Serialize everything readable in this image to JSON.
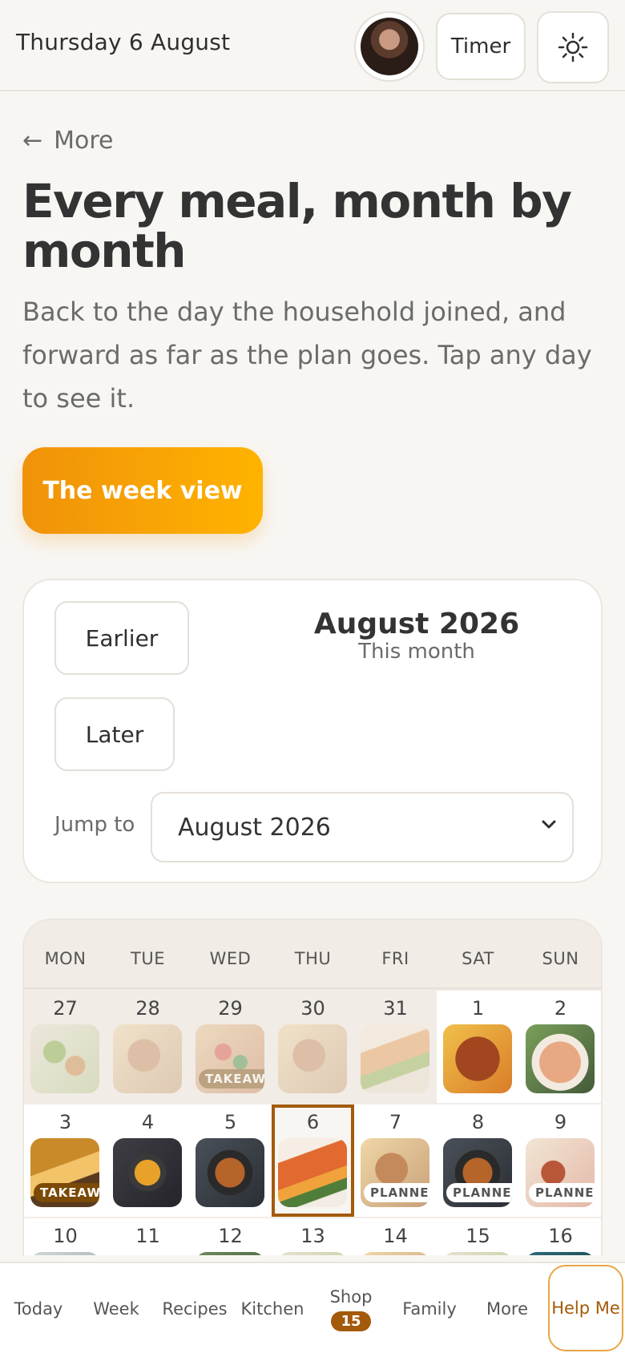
{
  "header": {
    "date": "Thursday 6 August",
    "timer_label": "Timer",
    "avatar_icon": "user-avatar",
    "theme_icon": "sun-icon"
  },
  "back": {
    "arrow": "←",
    "label": "More"
  },
  "page": {
    "title": "Every meal, month by month",
    "subtitle": "Back to the day the household joined, and forward as far as the plan goes. Tap any day to see it.",
    "week_button": "The week view"
  },
  "month_nav": {
    "earlier": "Earlier",
    "later": "Later",
    "month": "August 2026",
    "month_sub": "This month",
    "jump_label": "Jump to",
    "jump_value": "August 2026"
  },
  "calendar": {
    "weekdays": [
      "MON",
      "TUE",
      "WED",
      "THU",
      "FRI",
      "SAT",
      "SUN"
    ],
    "rows": [
      [
        {
          "day": "27",
          "in_month": false,
          "food": "salad"
        },
        {
          "day": "28",
          "in_month": false,
          "food": "meat"
        },
        {
          "day": "29",
          "in_month": false,
          "food": "pizza",
          "tag": "TAKEAWAY"
        },
        {
          "day": "30",
          "in_month": false,
          "food": "meat"
        },
        {
          "day": "31",
          "in_month": false,
          "food": "fish"
        },
        {
          "day": "1",
          "in_month": true,
          "food": "pasta"
        },
        {
          "day": "2",
          "in_month": true,
          "food": "rice"
        }
      ],
      [
        {
          "day": "3",
          "in_month": true,
          "food": "noodles",
          "tag": "TAKEAWAY"
        },
        {
          "day": "4",
          "in_month": true,
          "food": "soup"
        },
        {
          "day": "5",
          "in_month": true,
          "food": "noodlebowl"
        },
        {
          "day": "6",
          "in_month": true,
          "food": "salmon",
          "today": true
        },
        {
          "day": "7",
          "in_month": true,
          "food": "meat",
          "tag": "PLANNED"
        },
        {
          "day": "8",
          "in_month": true,
          "food": "noodlebowl",
          "tag": "PLANNED"
        },
        {
          "day": "9",
          "in_month": true,
          "food": "sausage",
          "tag": "PLANNED"
        }
      ],
      [
        {
          "day": "10",
          "in_month": true,
          "food": "plate"
        },
        {
          "day": "11",
          "in_month": true,
          "food": "none"
        },
        {
          "day": "12",
          "in_month": true,
          "food": "berry"
        },
        {
          "day": "13",
          "in_month": true,
          "food": "salad"
        },
        {
          "day": "14",
          "in_month": true,
          "food": "meat"
        },
        {
          "day": "15",
          "in_month": true,
          "food": "salad"
        },
        {
          "day": "16",
          "in_month": true,
          "food": "teal"
        }
      ]
    ]
  },
  "bottom_nav": {
    "today": "Today",
    "week": "Week",
    "recipes": "Recipes",
    "kitchen": "Kitchen",
    "shop": "Shop",
    "shop_badge": "15",
    "family": "Family",
    "more": "More",
    "help": "Help Me"
  },
  "colors": {
    "accent": "#f0920a",
    "accent_dark": "#a35a0a",
    "background": "#f8f6f3"
  }
}
